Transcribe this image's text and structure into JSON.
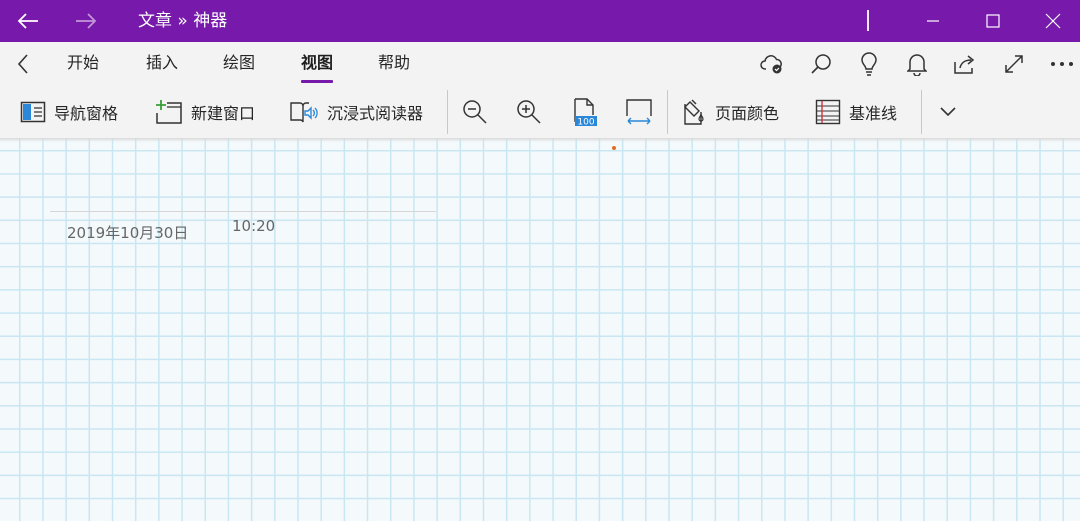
{
  "titlebar": {
    "title": "文章 » 神器"
  },
  "tabs": [
    {
      "label": "开始"
    },
    {
      "label": "插入"
    },
    {
      "label": "绘图"
    },
    {
      "label": "视图"
    },
    {
      "label": "帮助"
    }
  ],
  "active_tab": "视图",
  "right_icons": [
    "cloud-sync-icon",
    "search-icon",
    "lightbulb-icon",
    "bell-icon",
    "share-icon",
    "fullscreen-icon",
    "more-icon"
  ],
  "toolbar": {
    "nav_pane": "导航窗格",
    "new_window": "新建窗口",
    "immersive_reader": "沉浸式阅读器",
    "page_color": "页面颜色",
    "rule_lines": "基准线",
    "zoom_100_badge": "100"
  },
  "page": {
    "date": "2019年10月30日",
    "time": "10:20"
  },
  "colors": {
    "accent": "#7719aa",
    "grid_line": "#c9e6f3",
    "page_bg": "#f4f9fb",
    "cursor": "#e26b2a"
  }
}
